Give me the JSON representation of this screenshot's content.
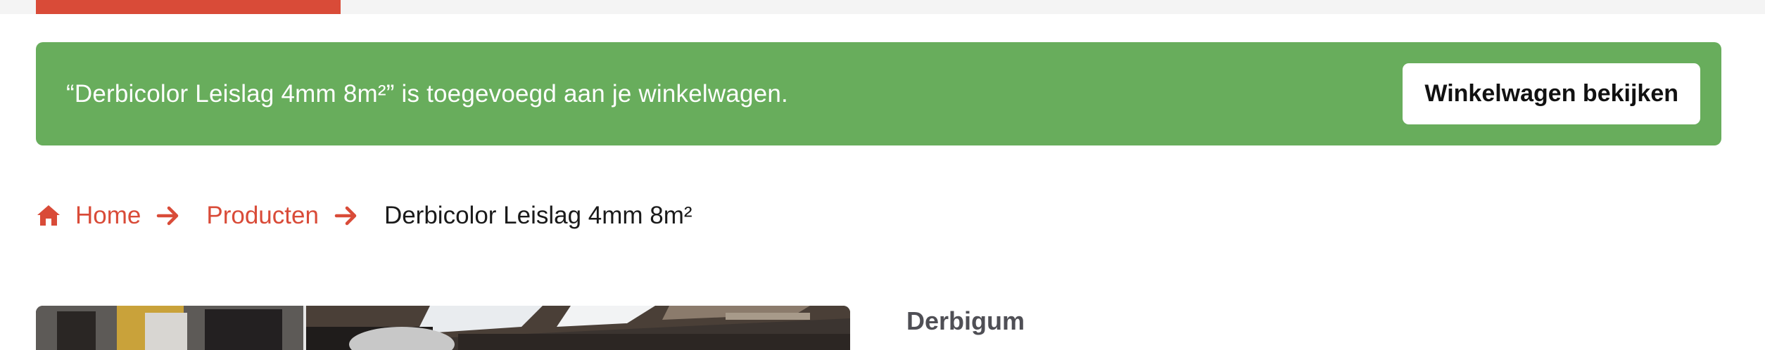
{
  "colors": {
    "accent": "#d94b38",
    "success": "#68ad5c",
    "text_dark": "#1a1a1a",
    "brand_text": "#4f4f55"
  },
  "notice": {
    "message": "“Derbicolor Leislag 4mm 8m²” is toegevoegd aan je winkelwagen.",
    "button_label": "Winkelwagen bekijken"
  },
  "breadcrumb": {
    "home_icon": "home-icon",
    "separator_icon": "arrow-right-icon",
    "home": "Home",
    "products": "Producten",
    "current": "Derbicolor Leislag 4mm 8m²"
  },
  "product": {
    "brand": "Derbigum"
  }
}
